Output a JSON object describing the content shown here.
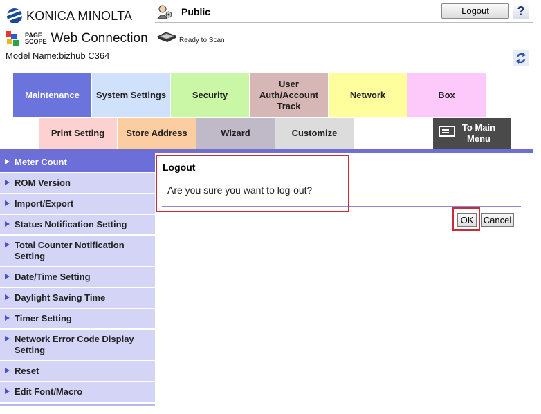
{
  "header": {
    "brand": "KONICA MINOLTA",
    "pagescope_line1": "PAGE",
    "pagescope_line2": "SCOPE",
    "product": "Web Connection",
    "model_name": "Model Name:bizhub C364",
    "user_mode": "Public",
    "status": "Ready to Scan",
    "logout_label": "Logout",
    "help_label": "?"
  },
  "tabs_primary": [
    {
      "label": "Maintenance",
      "active": true
    },
    {
      "label": "System Settings"
    },
    {
      "label": "Security"
    },
    {
      "label": "User Auth/Account Track"
    },
    {
      "label": "Network"
    },
    {
      "label": "Box"
    }
  ],
  "tabs_secondary": [
    {
      "label": "Print Setting"
    },
    {
      "label": "Store Address"
    },
    {
      "label": "Wizard"
    },
    {
      "label": "Customize"
    },
    {
      "label": "To Main Menu"
    }
  ],
  "sidebar": {
    "items": [
      {
        "label": "Meter Count",
        "active": true
      },
      {
        "label": "ROM Version"
      },
      {
        "label": "Import/Export"
      },
      {
        "label": "Status Notification Setting"
      },
      {
        "label": "Total Counter Notification Setting"
      },
      {
        "label": "Date/Time Setting"
      },
      {
        "label": "Daylight Saving Time"
      },
      {
        "label": "Timer Setting"
      },
      {
        "label": "Network Error Code Display Setting"
      },
      {
        "label": "Reset"
      },
      {
        "label": "Edit Font/Macro"
      }
    ]
  },
  "dialog": {
    "title": "Logout",
    "message": "Are you sure you want to log-out?",
    "ok_label": "OK",
    "cancel_label": "Cancel"
  },
  "colors": {
    "accent": "#6b73dc",
    "highlight": "#cc2a36"
  }
}
